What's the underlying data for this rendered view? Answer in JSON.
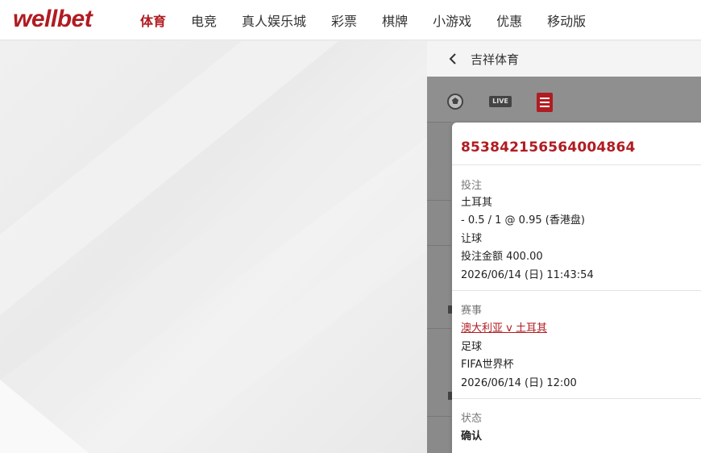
{
  "brand": {
    "logo_text": "wellbet",
    "brand_color": "#b01c22"
  },
  "nav": {
    "items": [
      {
        "label": "体育",
        "active": true
      },
      {
        "label": "电竞",
        "active": false
      },
      {
        "label": "真人娱乐城",
        "active": false
      },
      {
        "label": "彩票",
        "active": false
      },
      {
        "label": "棋牌",
        "active": false
      },
      {
        "label": "小游戏",
        "active": false
      },
      {
        "label": "优惠",
        "active": false
      },
      {
        "label": "移动版",
        "active": false
      }
    ]
  },
  "panel": {
    "title": "吉祥体育",
    "back_icon": "chevron-left-icon",
    "tabs": [
      {
        "icon": "soccer-ball-icon"
      },
      {
        "icon": "live-icon",
        "label": "LIVE"
      },
      {
        "icon": "bet-slip-icon"
      }
    ]
  },
  "ticket": {
    "id": "853842156564004864",
    "bet": {
      "label": "投注",
      "selection": "土耳其",
      "odds_line": "- 0.5 / 1 @ 0.95 (香港盘)",
      "market": "让球",
      "stake": "投注金额 400.00",
      "placed_at": "2026/06/14 (日) 11:43:54"
    },
    "event": {
      "label": "赛事",
      "match": "澳大利亚 v 土耳其",
      "sport": "足球",
      "competition": "FIFA世界杯",
      "start_time": "2026/06/14 (日) 12:00"
    },
    "status": {
      "label": "状态",
      "value": "确认"
    }
  }
}
